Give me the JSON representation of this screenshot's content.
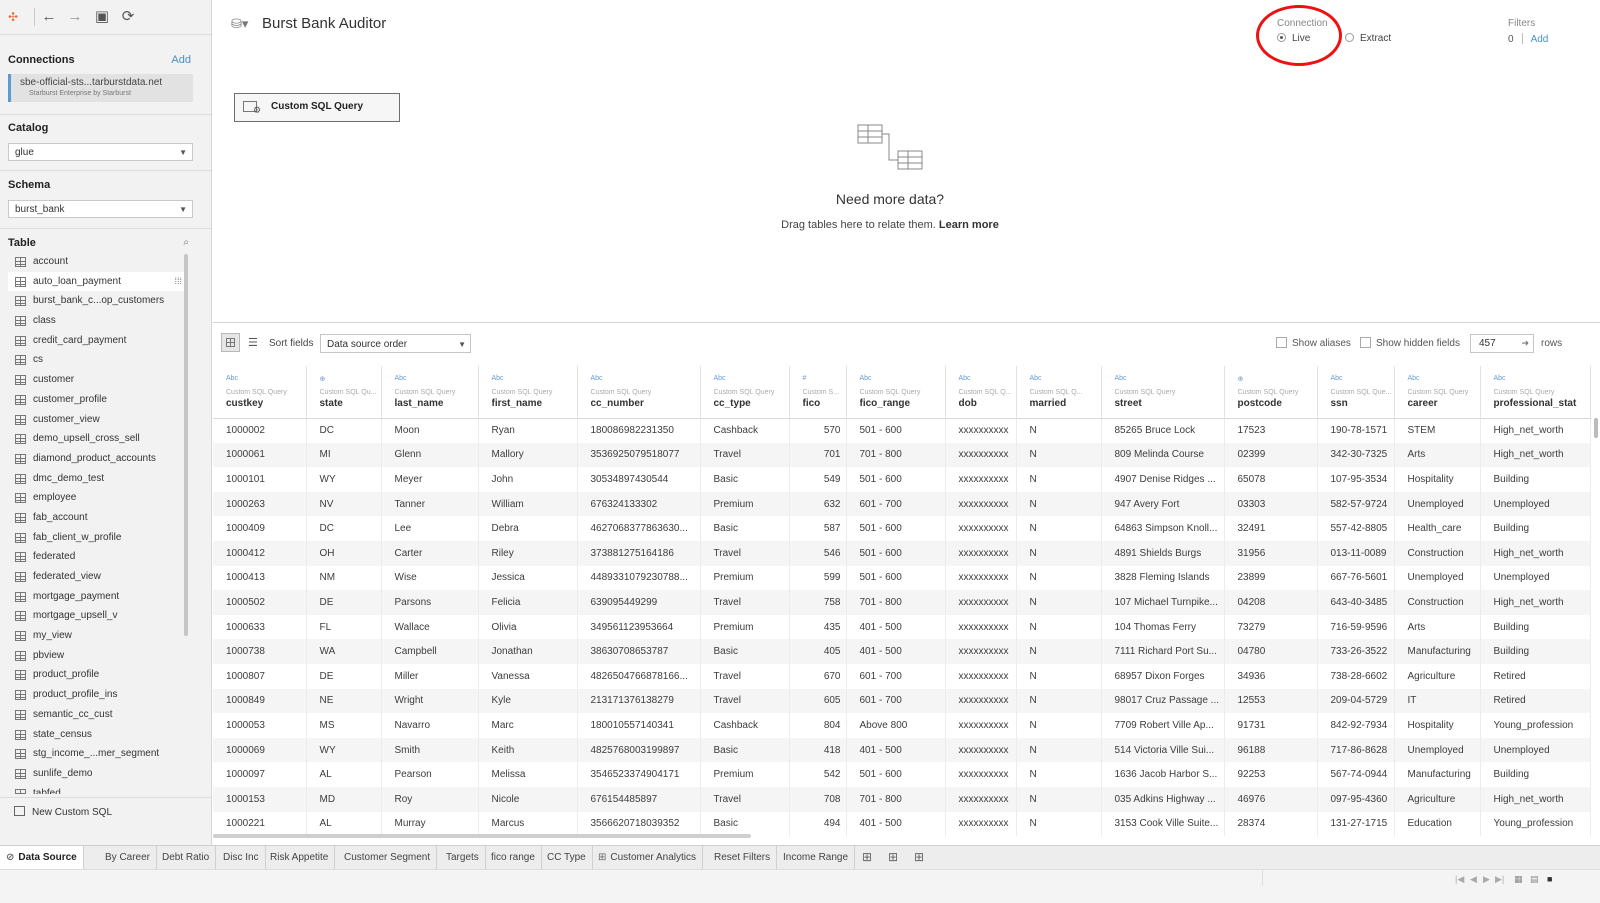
{
  "sidebar": {
    "toolbar": {
      "tableau_icon": "tableau-logo-icon",
      "back": "←",
      "forward": "→",
      "save": "▣",
      "refresh": "⟳"
    },
    "connections_title": "Connections",
    "add_label": "Add",
    "connection": {
      "name": "sbe-official-sts...tarburstdata.net",
      "subtitle": "Starburst Enterprise by Starburst"
    },
    "catalog_title": "Catalog",
    "catalog_value": "glue",
    "schema_title": "Schema",
    "schema_value": "burst_bank",
    "table_title": "Table",
    "tables": [
      "account",
      "auto_loan_payment",
      "burst_bank_c...op_customers",
      "class",
      "credit_card_payment",
      "cs",
      "customer",
      "customer_profile",
      "customer_view",
      "demo_upsell_cross_sell",
      "diamond_product_accounts",
      "dmc_demo_test",
      "employee",
      "fab_account",
      "fab_client_w_profile",
      "federated",
      "federated_view",
      "mortgage_payment",
      "mortgage_upsell_v",
      "my_view",
      "pbview",
      "product_profile",
      "product_profile_ins",
      "semantic_cc_cust",
      "state_census",
      "stg_income_...mer_segment",
      "sunlife_demo",
      "tabfed"
    ],
    "new_custom_sql": "New Custom SQL"
  },
  "header": {
    "title": "Burst Bank Auditor",
    "connection_label": "Connection",
    "live_label": "Live",
    "extract_label": "Extract",
    "filters_label": "Filters",
    "filters_count": "0",
    "filters_add": "Add"
  },
  "canvas": {
    "card_label": "Custom SQL Query",
    "need_more": "Need more data?",
    "drag_text": "Drag tables here to relate them.",
    "learn_more": "Learn more"
  },
  "gridbar": {
    "sort_label": "Sort fields",
    "sort_value": "Data source order",
    "show_aliases": "Show aliases",
    "show_hidden": "Show hidden fields",
    "rows_value": "457",
    "rows_label": "rows"
  },
  "grid": {
    "columns": [
      {
        "type": "Abc",
        "source": "Custom SQL Query",
        "name": "custkey"
      },
      {
        "type": "⊕",
        "source": "Custom SQL Qu...",
        "name": "state"
      },
      {
        "type": "Abc",
        "source": "Custom SQL Query",
        "name": "last_name"
      },
      {
        "type": "Abc",
        "source": "Custom SQL Query",
        "name": "first_name"
      },
      {
        "type": "Abc",
        "source": "Custom SQL Query",
        "name": "cc_number"
      },
      {
        "type": "Abc",
        "source": "Custom SQL Query",
        "name": "cc_type"
      },
      {
        "type": "#",
        "source": "Custom S...",
        "name": "fico"
      },
      {
        "type": "Abc",
        "source": "Custom SQL Query",
        "name": "fico_range"
      },
      {
        "type": "Abc",
        "source": "Custom SQL Q...",
        "name": "dob"
      },
      {
        "type": "Abc",
        "source": "Custom SQL Q...",
        "name": "married"
      },
      {
        "type": "Abc",
        "source": "Custom SQL Query",
        "name": "street"
      },
      {
        "type": "⊕",
        "source": "Custom SQL Query",
        "name": "postcode"
      },
      {
        "type": "Abc",
        "source": "Custom SQL Que...",
        "name": "ssn"
      },
      {
        "type": "Abc",
        "source": "Custom SQL Query",
        "name": "career"
      },
      {
        "type": "Abc",
        "source": "Custom SQL Query",
        "name": "professional_stat"
      }
    ],
    "rows": [
      [
        "1000002",
        "DC",
        "Moon",
        "Ryan",
        "180086982231350",
        "Cashback",
        "570",
        "501 - 600",
        "xxxxxxxxxx",
        "N",
        "85265 Bruce Lock",
        "17523",
        "190-78-1571",
        "STEM",
        "High_net_worth"
      ],
      [
        "1000061",
        "MI",
        "Glenn",
        "Mallory",
        "3536925079518077",
        "Travel",
        "701",
        "701 - 800",
        "xxxxxxxxxx",
        "N",
        "809 Melinda Course",
        "02399",
        "342-30-7325",
        "Arts",
        "High_net_worth"
      ],
      [
        "1000101",
        "WY",
        "Meyer",
        "John",
        "30534897430544",
        "Basic",
        "549",
        "501 - 600",
        "xxxxxxxxxx",
        "N",
        "4907 Denise Ridges ...",
        "65078",
        "107-95-3534",
        "Hospitality",
        "Building"
      ],
      [
        "1000263",
        "NV",
        "Tanner",
        "William",
        "676324133302",
        "Premium",
        "632",
        "601 - 700",
        "xxxxxxxxxx",
        "N",
        "947 Avery Fort",
        "03303",
        "582-57-9724",
        "Unemployed",
        "Unemployed"
      ],
      [
        "1000409",
        "DC",
        "Lee",
        "Debra",
        "4627068377863630...",
        "Basic",
        "587",
        "501 - 600",
        "xxxxxxxxxx",
        "N",
        "64863 Simpson Knoll...",
        "32491",
        "557-42-8805",
        "Health_care",
        "Building"
      ],
      [
        "1000412",
        "OH",
        "Carter",
        "Riley",
        "373881275164186",
        "Travel",
        "546",
        "501 - 600",
        "xxxxxxxxxx",
        "N",
        "4891 Shields Burgs",
        "31956",
        "013-11-0089",
        "Construction",
        "High_net_worth"
      ],
      [
        "1000413",
        "NM",
        "Wise",
        "Jessica",
        "4489331079230788...",
        "Premium",
        "599",
        "501 - 600",
        "xxxxxxxxxx",
        "N",
        "3828 Fleming Islands",
        "23899",
        "667-76-5601",
        "Unemployed",
        "Unemployed"
      ],
      [
        "1000502",
        "DE",
        "Parsons",
        "Felicia",
        "639095449299",
        "Travel",
        "758",
        "701 - 800",
        "xxxxxxxxxx",
        "N",
        "107 Michael Turnpike...",
        "04208",
        "643-40-3485",
        "Construction",
        "High_net_worth"
      ],
      [
        "1000633",
        "FL",
        "Wallace",
        "Olivia",
        "349561123953664",
        "Premium",
        "435",
        "401 - 500",
        "xxxxxxxxxx",
        "N",
        "104 Thomas Ferry",
        "73279",
        "716-59-9596",
        "Arts",
        "Building"
      ],
      [
        "1000738",
        "WA",
        "Campbell",
        "Jonathan",
        "38630708653787",
        "Basic",
        "405",
        "401 - 500",
        "xxxxxxxxxx",
        "N",
        "7111 Richard Port Su...",
        "04780",
        "733-26-3522",
        "Manufacturing",
        "Building"
      ],
      [
        "1000807",
        "DE",
        "Miller",
        "Vanessa",
        "4826504766878166...",
        "Travel",
        "670",
        "601 - 700",
        "xxxxxxxxxx",
        "N",
        "68957 Dixon Forges",
        "34936",
        "738-28-6602",
        "Agriculture",
        "Retired"
      ],
      [
        "1000849",
        "NE",
        "Wright",
        "Kyle",
        "213171376138279",
        "Travel",
        "605",
        "601 - 700",
        "xxxxxxxxxx",
        "N",
        "98017 Cruz Passage ...",
        "12553",
        "209-04-5729",
        "IT",
        "Retired"
      ],
      [
        "1000053",
        "MS",
        "Navarro",
        "Marc",
        "180010557140341",
        "Cashback",
        "804",
        "Above 800",
        "xxxxxxxxxx",
        "N",
        "7709 Robert Ville Ap...",
        "91731",
        "842-92-7934",
        "Hospitality",
        "Young_profession"
      ],
      [
        "1000069",
        "WY",
        "Smith",
        "Keith",
        "4825768003199897",
        "Basic",
        "418",
        "401 - 500",
        "xxxxxxxxxx",
        "N",
        "514 Victoria Ville Sui...",
        "96188",
        "717-86-8628",
        "Unemployed",
        "Unemployed"
      ],
      [
        "1000097",
        "AL",
        "Pearson",
        "Melissa",
        "3546523374904171",
        "Premium",
        "542",
        "501 - 600",
        "xxxxxxxxxx",
        "N",
        "1636 Jacob Harbor S...",
        "92253",
        "567-74-0944",
        "Manufacturing",
        "Building"
      ],
      [
        "1000153",
        "MD",
        "Roy",
        "Nicole",
        "676154485897",
        "Travel",
        "708",
        "701 - 800",
        "xxxxxxxxxx",
        "N",
        "035 Adkins Highway ...",
        "46976",
        "097-95-4360",
        "Agriculture",
        "High_net_worth"
      ],
      [
        "1000221",
        "AL",
        "Murray",
        "Marcus",
        "3566620718039352",
        "Basic",
        "494",
        "401 - 500",
        "xxxxxxxxxx",
        "N",
        "3153 Cook Ville Suite...",
        "28374",
        "131-27-1715",
        "Education",
        "Young_profession"
      ]
    ]
  },
  "tabs": [
    {
      "label": "Data Source",
      "icon": "⊘"
    },
    {
      "label": "By Career"
    },
    {
      "label": "Debt Ratio"
    },
    {
      "label": "Disc Inc"
    },
    {
      "label": "Risk Appetite"
    },
    {
      "label": "Customer Segment"
    },
    {
      "label": "Targets"
    },
    {
      "label": "fico range"
    },
    {
      "label": "CC Type"
    },
    {
      "label": "Customer Analytics",
      "icon": "⊞"
    },
    {
      "label": "Reset Filters"
    },
    {
      "label": "Income Range"
    }
  ]
}
